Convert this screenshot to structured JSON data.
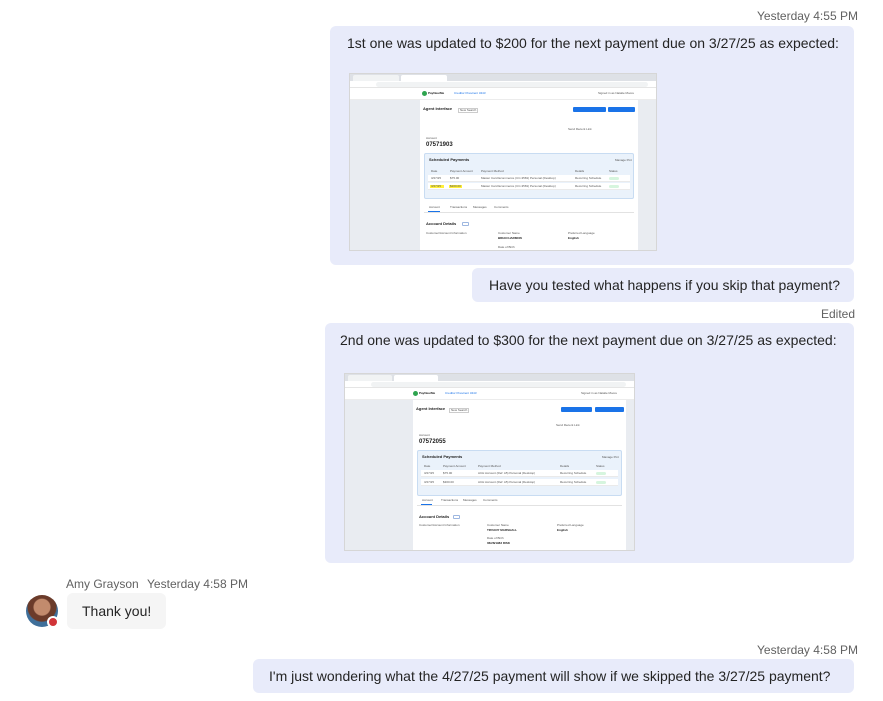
{
  "messages": [
    {
      "time": "Yesterday 4:55 PM",
      "text": "1st one was updated to $200 for the next payment due on 3/27/25 as expected:"
    },
    {
      "text": "Have you tested what happens if you skip that payment?"
    },
    {
      "edited": "Edited",
      "text": "2nd one was updated to $300 for the next payment due on 3/27/25 as expected:"
    },
    {
      "time": "Yesterday 4:58 PM",
      "text": "I'm just wondering what the 4/27/25 payment will show if we skipped the 3/27/25 payment?"
    }
  ],
  "incoming": {
    "sender": "Amy Grayson",
    "time": "Yesterday 4:58 PM",
    "text": "Thank you!",
    "presence": "busy",
    "avatar_icon": "user-avatar-icon"
  },
  "screenshot1": {
    "brand": "PayNearMe",
    "brand_sub": "Creditor Prescient 3443",
    "signed_in": "Signed in as Natalie Moore",
    "title": "Agent Interface",
    "new_search": "New Search",
    "btn_primary": "View Prior Payment",
    "btn_secondary": "Print Case Details",
    "account_label": "Account",
    "account": "07571903",
    "send_link": "Send Recent Link",
    "section": "Scheduled Payments",
    "manage": "Manage Pmt",
    "headers": [
      "Date",
      "Payment Amount",
      "Payment Method",
      "Details",
      "Status"
    ],
    "rows": [
      [
        "3/27/25",
        "$75.00",
        "Master Card Ecommerce (CC-3581) Personal (Desktop)",
        "Recurring Schedule",
        "Created"
      ],
      [
        "3/27/25",
        "$200.00",
        "Master Card Ecommerce (CC-3581) Personal (Desktop)",
        "Recurring Schedule",
        "Scheduled"
      ]
    ],
    "tabs": [
      "Account",
      "Transactions",
      "Messages",
      "Comments"
    ],
    "details": "Account Details",
    "details_btn": "Edit",
    "customer_label": "Customer/Account Information",
    "name_label": "Customer Name",
    "name": "BRIAN HARMON",
    "lang_label": "Preferred Language",
    "lang": "English",
    "dob_label": "Date of Birth"
  },
  "screenshot2": {
    "brand": "PayNearMe",
    "brand_sub": "Creditor Prescient 3443",
    "signed_in": "Signed in as Natalie Moore",
    "title": "Agent Interface",
    "new_search": "New Search",
    "btn_primary": "View Prior Payment",
    "btn_secondary": "Print Case Details",
    "account_label": "Account",
    "account": "07572055",
    "send_link": "Send Recent Link",
    "section": "Scheduled Payments",
    "manage": "Manage Pmt",
    "headers": [
      "Date",
      "Payment Amount",
      "Payment Method",
      "Details",
      "Status"
    ],
    "rows": [
      [
        "3/27/25",
        "$75.00",
        "ACH Account (Ref: A5) Personal (Desktop)",
        "Recurring Schedule",
        "Created"
      ],
      [
        "3/27/25",
        "$300.00",
        "ACH Account (Ref: A5) Personal (Desktop)",
        "Recurring Schedule",
        "Scheduled"
      ]
    ],
    "tabs": [
      "Account",
      "Transactions",
      "Messages",
      "Comments"
    ],
    "details": "Account Details",
    "details_btn": "Edit",
    "customer_label": "Customer/Account Information",
    "name_label": "Customer Name",
    "name": "TIFFANY MARSHALL",
    "lang_label": "Preferred Language",
    "lang": "English",
    "dob_label": "Date of Birth",
    "dob": "06/28/1983 RISK"
  },
  "colors": {
    "outgoing_bubble": "#e8ebfa",
    "incoming_bubble": "#f5f5f5",
    "timestamp": "#616161",
    "presence_busy": "#d13438",
    "app_accent": "#1a73e8",
    "highlight": "#ffef3a"
  }
}
